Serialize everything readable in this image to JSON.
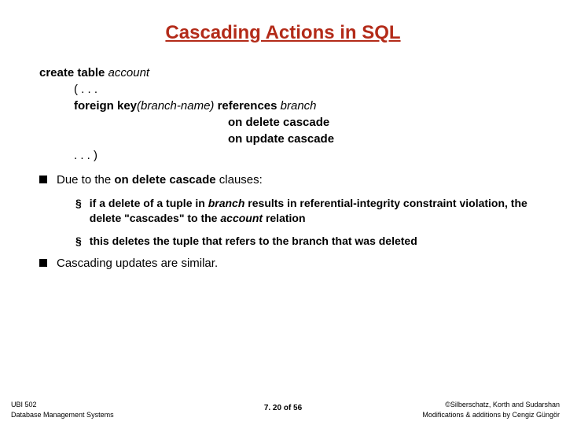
{
  "title": "Cascading Actions in SQL",
  "code": {
    "line1_a": "create table ",
    "line1_b": "account",
    "line2": "( . . .",
    "line3_a": "foreign key",
    "line3_b": "(branch-name)",
    "line3_c": "  ",
    "line3_d": "references ",
    "line3_e": "branch",
    "line4": "on delete cascade",
    "line5": "on update cascade",
    "line6": ". . . )"
  },
  "bullets": [
    {
      "prefix": "Due to the ",
      "strong": "on delete cascade",
      "suffix": " clauses:",
      "subs": [
        {
          "parts": [
            {
              "t": "if a delete of a tuple in ",
              "i": false
            },
            {
              "t": "branch",
              "i": true
            },
            {
              "t": " results in referential-integrity constraint violation, the delete \"cascades\" to the ",
              "i": false
            },
            {
              "t": "account",
              "i": true
            },
            {
              "t": " relation",
              "i": false
            }
          ]
        },
        {
          "parts": [
            {
              "t": "this deletes the tuple that refers to the branch that was deleted",
              "i": false
            }
          ]
        }
      ]
    },
    {
      "prefix": "Cascading updates are similar.",
      "strong": "",
      "suffix": "",
      "subs": []
    }
  ],
  "footer": {
    "course": "UBI 502",
    "dept": "Database Management Systems",
    "copyright": "©Silberschatz, Korth and Sudarshan",
    "mods": "Modifications & additions by Cengiz Güngör",
    "page": "7. 20 of 56"
  }
}
